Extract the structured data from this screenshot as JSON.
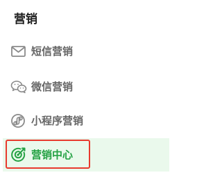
{
  "section": {
    "title": "营销"
  },
  "menu": {
    "items": [
      {
        "label": "短信营销",
        "icon": "envelope-icon",
        "active": false
      },
      {
        "label": "微信营销",
        "icon": "wechat-icon",
        "active": false
      },
      {
        "label": "小程序营销",
        "icon": "mini-program-icon",
        "active": false
      },
      {
        "label": "营销中心",
        "icon": "target-icon",
        "active": true
      }
    ]
  },
  "colors": {
    "active_text": "#25a244",
    "active_background": "#eaf9ec",
    "active_outline": "#e83a2e",
    "inactive_text": "#666666",
    "title_text": "#1f1f1f"
  }
}
